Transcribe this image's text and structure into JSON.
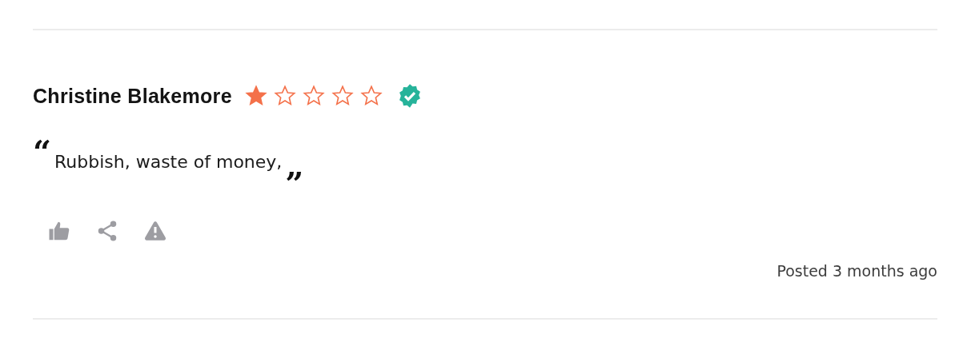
{
  "review": {
    "author": "Christine Blakemore",
    "stars": 1,
    "verified": true,
    "open_quote": "“",
    "text": "Rubbish, waste of money,",
    "close_quote": "”",
    "posted": "Posted 3 months ago"
  }
}
